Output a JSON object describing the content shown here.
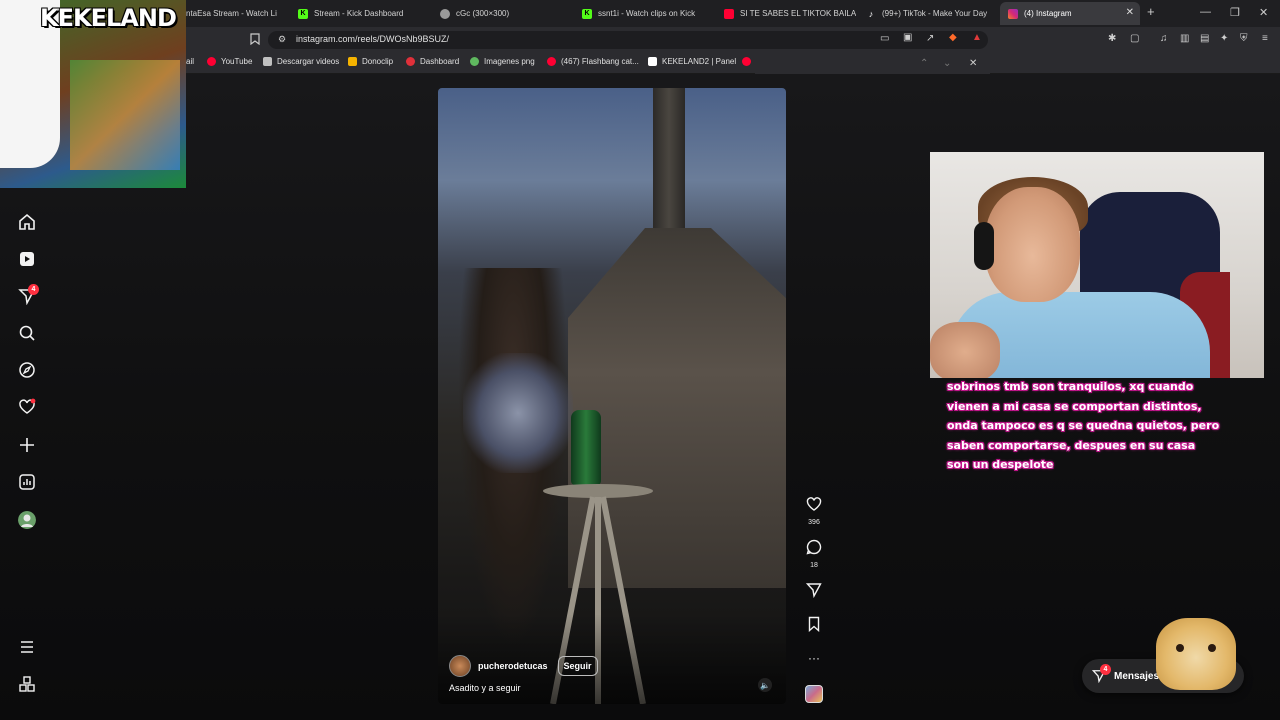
{
  "browser": {
    "tabs": [
      {
        "label": "ntaEsa Stream - Watch Li",
        "icon": "stream-icon",
        "color": "#8a8a8a"
      },
      {
        "label": "Stream - Kick Dashboard",
        "icon": "kick-icon",
        "color": "#53fc18"
      },
      {
        "label": "cGc (300×300)",
        "icon": "globe-icon",
        "color": "#9a9a9a"
      },
      {
        "label": "ssnt1i - Watch clips on Kick",
        "icon": "kick-icon",
        "color": "#53fc18"
      },
      {
        "label": "SI TE SABES EL TIKTOK BAILA!",
        "icon": "youtube-icon",
        "color": "#ff0033"
      },
      {
        "label": "(99+) TikTok - Make Your Day",
        "icon": "tiktok-icon",
        "color": "#ffffff"
      },
      {
        "label": "(4) Instagram",
        "icon": "instagram-icon",
        "color": "#d62976",
        "active": true
      }
    ],
    "url": "instagram.com/reels/DWOsNb9BSUZ/",
    "bookmarks": [
      {
        "label": "ail",
        "color": "#888888"
      },
      {
        "label": "YouTube",
        "color": "#ff0033"
      },
      {
        "label": "Descargar videos",
        "color": "#c0c0c0"
      },
      {
        "label": "Donoclip",
        "color": "#f5b300"
      },
      {
        "label": "Dashboard",
        "color": "#e0303a"
      },
      {
        "label": "Imagenes png",
        "color": "#5fb85f"
      },
      {
        "label": "(467) Flashbang cat...",
        "color": "#ff0033"
      },
      {
        "label": "KEKELAND2 | Panel",
        "color": "#ffffff"
      }
    ]
  },
  "overlay": {
    "logo_text": "KEKELAND"
  },
  "sidebar": {
    "items": [
      {
        "name": "home-icon"
      },
      {
        "name": "reels-icon"
      },
      {
        "name": "messages-icon",
        "badge": "4"
      },
      {
        "name": "search-icon"
      },
      {
        "name": "explore-icon"
      },
      {
        "name": "notifications-icon"
      },
      {
        "name": "create-icon"
      },
      {
        "name": "dashboard-icon"
      },
      {
        "name": "profile-avatar"
      }
    ],
    "bottom": [
      "menu-icon",
      "apps-icon"
    ]
  },
  "reel": {
    "author": "pucherodetucas",
    "follow_label": "Seguir",
    "caption": "Asadito y a seguir",
    "likes": "396",
    "comments": "18"
  },
  "stream_chat": {
    "lines": [
      "sobrinos tmb son tranquilos, xq cuando",
      "vienen a mi casa se comportan distintos,",
      "onda tampoco es q se quedna quietos, pero",
      "saben comportarse, despues en su casa",
      "son un despelote"
    ]
  },
  "messages": {
    "label": "Mensajes",
    "badge": "4"
  },
  "colors": {
    "notify_red": "#ff3040",
    "chat_glow": "#ff2db4"
  }
}
